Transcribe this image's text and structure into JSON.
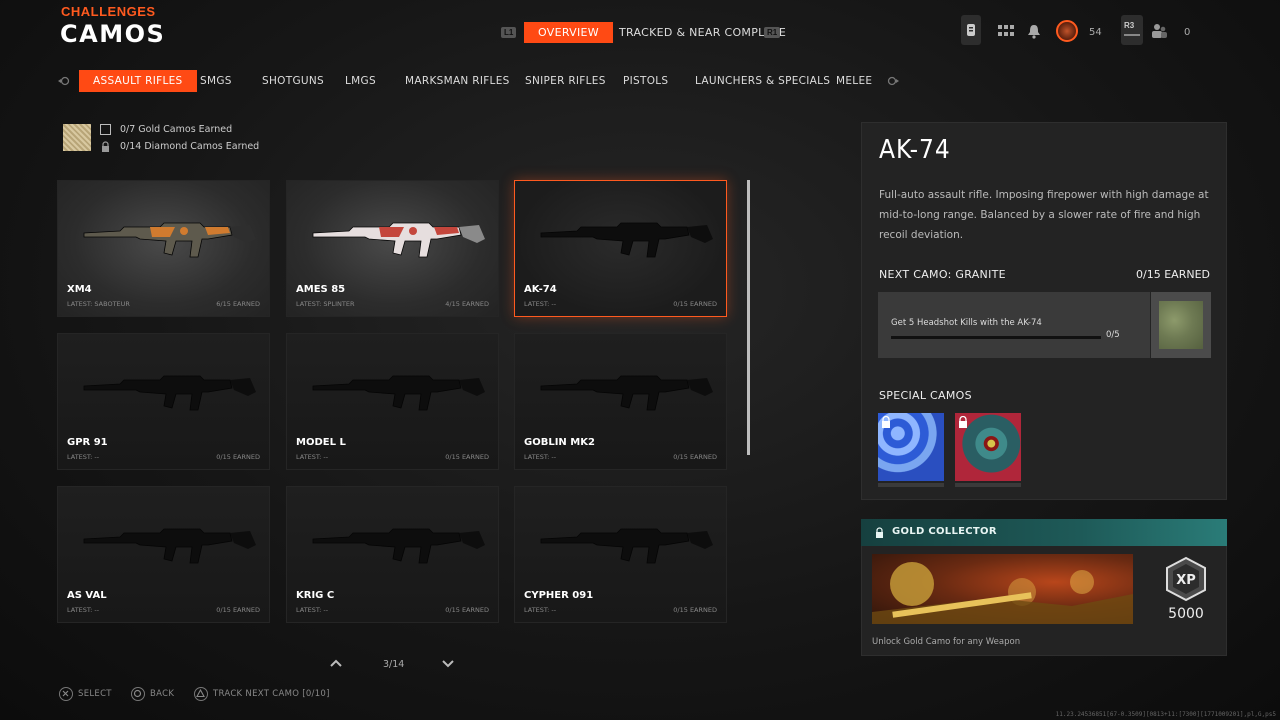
{
  "header": {
    "subtitle": "CHALLENGES",
    "title": "CAMOS",
    "left_bumper": "L1",
    "right_bumper": "R1",
    "tabs": [
      {
        "label": "OVERVIEW",
        "active": true
      },
      {
        "label": "TRACKED & NEAR COMPLETE",
        "active": false
      }
    ]
  },
  "status": {
    "player_level": "54",
    "r3_label": "R3",
    "party_count": "0"
  },
  "categories": [
    {
      "label": "ASSAULT RIFLES",
      "active": true
    },
    {
      "label": "SMGS"
    },
    {
      "label": "SHOTGUNS"
    },
    {
      "label": "LMGS"
    },
    {
      "label": "MARKSMAN RIFLES"
    },
    {
      "label": "SNIPER RIFLES"
    },
    {
      "label": "PISTOLS"
    },
    {
      "label": "LAUNCHERS & SPECIALS"
    },
    {
      "label": "MELEE"
    }
  ],
  "summary": {
    "gold": "0/7 Gold Camos Earned",
    "diamond": "0/14 Diamond Camos Earned"
  },
  "weapons": [
    {
      "name": "XM4",
      "latest": "LATEST: SABOTEUR",
      "earned": "6/15 EARNED",
      "camo": "orange"
    },
    {
      "name": "AMES 85",
      "latest": "LATEST: SPLINTER",
      "earned": "4/15 EARNED",
      "camo": "red-white"
    },
    {
      "name": "AK-74",
      "latest": "LATEST: --",
      "earned": "0/15 EARNED",
      "selected": true
    },
    {
      "name": "GPR 91",
      "latest": "LATEST: --",
      "earned": "0/15 EARNED"
    },
    {
      "name": "MODEL L",
      "latest": "LATEST: --",
      "earned": "0/15 EARNED"
    },
    {
      "name": "GOBLIN MK2",
      "latest": "LATEST: --",
      "earned": "0/15 EARNED"
    },
    {
      "name": "AS VAL",
      "latest": "LATEST: --",
      "earned": "0/15 EARNED"
    },
    {
      "name": "KRIG C",
      "latest": "LATEST: --",
      "earned": "0/15 EARNED"
    },
    {
      "name": "CYPHER 091",
      "latest": "LATEST: --",
      "earned": "0/15 EARNED"
    }
  ],
  "pager": {
    "page": "3/14"
  },
  "detail": {
    "name": "AK-74",
    "description": "Full-auto assault rifle.  Imposing firepower with high damage at mid-to-long range. Balanced by a slower rate of fire and high recoil deviation.",
    "next_camo_label": "NEXT CAMO: GRANITE",
    "next_camo_earned": "0/15 EARNED",
    "challenge": "Get 5 Headshot Kills with the AK-74",
    "challenge_progress": "0/5",
    "challenge_fraction": 0,
    "special_label": "SPECIAL CAMOS"
  },
  "gold_collector": {
    "title": "GOLD COLLECTOR",
    "xp": "5000",
    "xp_badge": "XP",
    "description": "Unlock Gold Camo for any Weapon"
  },
  "footer": {
    "select": "SELECT",
    "back": "BACK",
    "track": "TRACK NEXT CAMO [0/10]",
    "build": "11.23.24536851[67-0.3509][0813+11:[7300][1771009201],pl,G,ps5"
  },
  "colors": {
    "accent": "#ff4a14",
    "teal": "#1e5a58"
  }
}
